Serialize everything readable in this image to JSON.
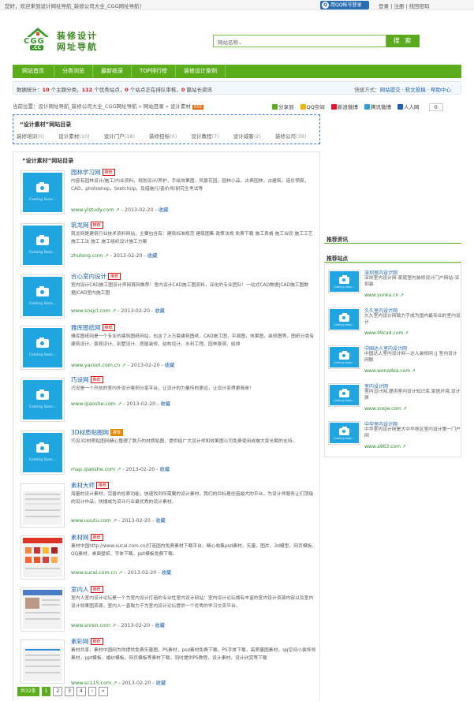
{
  "topbar": {
    "welcome": "您好，欢迎来到设计网址导航_装修公司大全_CGG网址导航！",
    "qq_login": "用QQ帐号登录",
    "links": "登录 | 注册 | 找回密码"
  },
  "header": {
    "logo_text": "CGG",
    "logo_sub": ".CC",
    "brand_line1": "装修设计",
    "brand_line2": "网址导航",
    "search_select": "网站名称",
    "search_button": "搜 索"
  },
  "nav": {
    "items": [
      "网站首页",
      "分类浏览",
      "最新收录",
      "TOP排行榜",
      "装修设计案例"
    ]
  },
  "stats": {
    "prefix": "数据统计：",
    "cats": "10",
    "cats_label": " 个主题分类，",
    "sites": "112",
    "sites_label": " 个优秀站点，",
    "pending": "0",
    "pending_label": " 个站点正在排队审核，",
    "news": "0",
    "news_label": " 篇站长资讯",
    "quick": "快捷方式：",
    "quick_links": "网站提交 · 软文投稿 · 帮助中心"
  },
  "breadcrumb": {
    "text": "当前位置：设计网址导航_装修公司大全_CGG网址导航 » 网站目录 » 设计素材",
    "rss": "RSS"
  },
  "share": {
    "items": [
      "分享到",
      "QQ空间",
      "新浪微博",
      "腾讯微博",
      "人人网"
    ],
    "count": "0"
  },
  "category": {
    "title": "“设计素材”网站目录",
    "items": [
      {
        "name": "装修培训",
        "count": "(0)"
      },
      {
        "name": "设计素材",
        "count": "(10)"
      },
      {
        "name": "设计门户",
        "count": "(18)"
      },
      {
        "name": "装修招标",
        "count": "(0)"
      },
      {
        "name": "设计教程",
        "count": "(7)"
      },
      {
        "name": "设计威客",
        "count": "(2)"
      },
      {
        "name": "装修公司",
        "count": "(38)"
      }
    ]
  },
  "main": {
    "title": "“设计素材”网站目录",
    "coming_soon": "Coming Soon...",
    "date": "2013-02-20",
    "vote": "收藏",
    "entries": [
      {
        "name": "园林学习网",
        "badge": "推荐",
        "desc": "内容有园林设计/施工/内业资料，规划设计/养护，手绘效果图，风景花园，园林小品，古典园林，古建筑，造价预算，CAD，photoshop，SketchUp，及措施行/造价师/研究生考试等",
        "url": "www.ylstudy.com"
      },
      {
        "name": "筑龙网",
        "badge": "推荐",
        "desc": "筑龙网是建筑行业技术资料网站，主要包含有：建筑标准规范 建筑图集 政策法规 免费下载 施工表格 施工合同 施工工艺 施工工法 施工 施工组织设计施工方案",
        "url": "zhulong.com"
      },
      {
        "name": "合心室内设计",
        "badge": "推荐",
        "desc": "室内设计CAD施工图设计师网首网推荐！室内设计CAD施工图资料，深化的专业团队！一站式CAD数据|CAD施工图数据|CAD室内施工图",
        "url": "www.snsjcl.com"
      },
      {
        "name": "雅库图纸网",
        "badge": "推荐",
        "desc": "雅库图纸网是一个专业的建筑图纸网站，包含了上万套建筑图纸，CAD施工图，平面图，效果图，装修图等，图纸分类有建筑设计、景观设计、别墅设计、房屋装修、结构设计、水利工程、园林景观、给排",
        "url": "www.yacool.com.cn"
      },
      {
        "name": "巧设网",
        "badge": "推荐",
        "desc": "巧设是一个开放的室内外设计案例分享平台，让设计的力量传的更远，让设计变得更简单！",
        "url": "www.qiaoshe.com"
      },
      {
        "name": "3D材质贴图网",
        "badge": "推荐",
        "desc": "巧设3D材质贴图网精心整理了数万的材质贴图，提供给广大设计师和效果图公司免费使用或做大家长期的支持。",
        "url": "map.qiaoshe.com"
      },
      {
        "name": "素材大师",
        "badge": "推荐",
        "desc": "海量的设计素材，完善的检索功能，快速找到所需要的设计素材，我们的目标是创造最大的平台，为设计师服务让们顶级的设计作品，快捷成为设计行业最优秀的设计素材。",
        "url": "www.uuutu.com"
      },
      {
        "name": "素材网",
        "badge": "推荐",
        "desc": "素材中国http://www.sucai.com.cn/打造国内免费素材下载平台，精心收集psd素材、矢量、图片、3d模型、网页模板、QQ素材、桌面壁纸、字体下载、ppt模板免费下载。",
        "url": "www.sucai.com.cn"
      },
      {
        "name": "室内人",
        "badge": "推荐",
        "desc": "室内人室内设计论坛是一个为室内设计打造的专业性室内设计网站：室内设计论坛拥有丰富的室内设计资源内容以及室内设计效果图资源，室内人一直致力于为室内设计论坛提供一个优秀的学习交流平台。",
        "url": "www.snren.com"
      },
      {
        "name": "素彩网",
        "badge": "推荐",
        "desc": "素材共享，素材中国网为你提供免费矢量图，PS素材，psd素材免费下载，PS字体下载，高质量图素材，qq空间小装饰领素材，ppt模板，婚纱模板，网页模板等素材下载，同时提供PS教程，设计素材，设计欣赏等下载",
        "url": "www.sc115.com"
      }
    ]
  },
  "pager": {
    "total": "共32条",
    "pages": [
      "1",
      "2",
      "3",
      "4"
    ],
    "current": "1",
    "next": "›",
    "last": "»"
  },
  "sidebar": {
    "news_title": "推荐资讯",
    "sites_title": "推荐站点",
    "sites": [
      {
        "title": "深圳室内设计网",
        "desc": "深圳室内设计网-家庭室内装修设计门户网站-深圳装",
        "url": "www.yunka.cn"
      },
      {
        "title": "久久室内设计网",
        "desc": "久久室内设计网致力于成为国内最专业的室内设计",
        "url": "www.99cad.com"
      },
      {
        "title": "中国达人室内设计网",
        "desc": "中国达人室内设计网—达人装修网 || 室内设计网联",
        "url": "www.wonadea.com"
      },
      {
        "title": "室内设计网",
        "desc": "室内设计网,提供室内设计知识库,家居环境,设计原",
        "url": "www.snsjw.com"
      },
      {
        "title": "中华室内设计网",
        "desc": "中华室内设计网是大中华地区室内设计第一门户网",
        "url": "www.a963.com"
      }
    ]
  },
  "colors": {
    "brand_green": "#5bad1c",
    "link_blue": "#1a5fb0",
    "url_green": "#2d8a2d",
    "placeholder_blue": "#1fa5e0",
    "number_red": "#dd1111"
  }
}
